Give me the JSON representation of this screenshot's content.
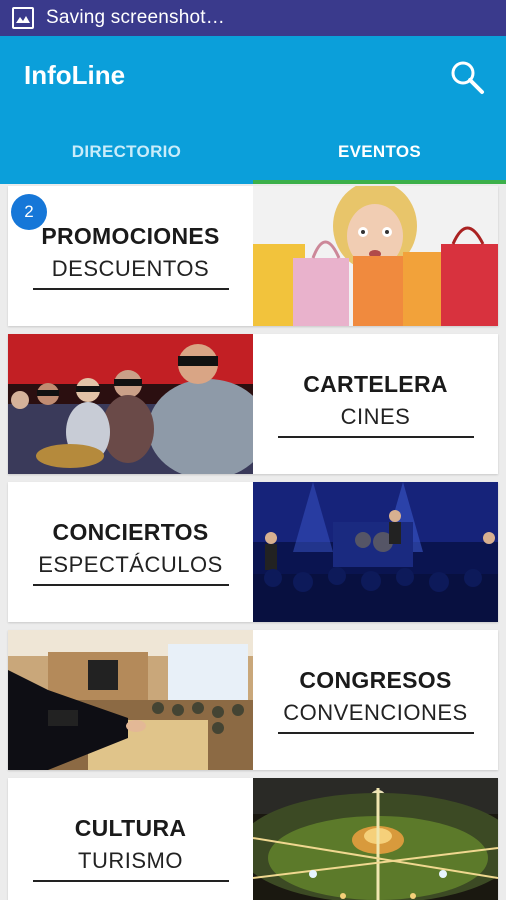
{
  "status_bar": {
    "icon": "image-icon",
    "text": "Saving screenshot…"
  },
  "app_bar": {
    "title": "InfoLine",
    "search_icon": "search-icon"
  },
  "tabs": [
    {
      "label": "DIRECTORIO",
      "active": false
    },
    {
      "label": "EVENTOS",
      "active": true
    }
  ],
  "badge": {
    "count": "2"
  },
  "items": [
    {
      "title": "PROMOCIONES",
      "subtitle": "DESCUENTOS",
      "image": "shopping-woman-photo"
    },
    {
      "title": "CARTELERA",
      "subtitle": "CINES",
      "image": "cinema-3d-audience-photo"
    },
    {
      "title": "CONCIERTOS",
      "subtitle": "ESPECTÁCULOS",
      "image": "concert-stage-photo"
    },
    {
      "title": "CONGRESOS",
      "subtitle": "CONVENCIONES",
      "image": "conference-hall-photo"
    },
    {
      "title": "CULTURA",
      "subtitle": "TURISMO",
      "image": "night-city-aerial-photo"
    }
  ],
  "colors": {
    "status_bar": "#3a3a8c",
    "app_bar": "#0b9fda",
    "tab_indicator": "#3cb04a",
    "badge": "#1677d8"
  }
}
